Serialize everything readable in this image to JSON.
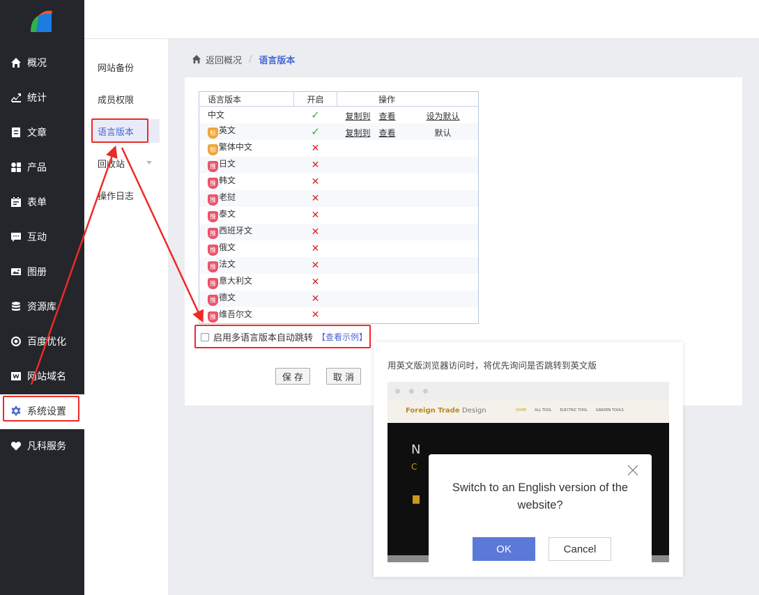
{
  "sidebar": {
    "items": [
      {
        "label": "概况",
        "icon": "home-icon"
      },
      {
        "label": "统计",
        "icon": "chart-icon"
      },
      {
        "label": "文章",
        "icon": "article-icon"
      },
      {
        "label": "产品",
        "icon": "grid-icon"
      },
      {
        "label": "表单",
        "icon": "calendar-icon"
      },
      {
        "label": "互动",
        "icon": "chat-icon"
      },
      {
        "label": "图册",
        "icon": "image-icon"
      },
      {
        "label": "资源库",
        "icon": "database-icon"
      },
      {
        "label": "百度优化",
        "icon": "target-icon"
      },
      {
        "label": "网站域名",
        "icon": "w-icon"
      },
      {
        "label": "系统设置",
        "icon": "gear-icon"
      },
      {
        "label": "凡科服务",
        "icon": "heart-icon"
      }
    ]
  },
  "submenu": {
    "items": [
      "网站备份",
      "成员权限",
      "语言版本",
      "回收站",
      "操作日志"
    ]
  },
  "breadcrumb": {
    "back": "返回概况",
    "sep": "/",
    "current": "语言版本"
  },
  "table": {
    "headers": [
      "语言版本",
      "开启",
      "操作"
    ],
    "rows": [
      {
        "name": "中文",
        "tag": "",
        "enabled": true,
        "copy": "复制到",
        "view": "查看",
        "default": "设为默认"
      },
      {
        "name": "英文",
        "tag": "标",
        "enabled": true,
        "copy": "复制到",
        "view": "查看",
        "default": "默认"
      },
      {
        "name": "繁体中文",
        "tag": "标",
        "enabled": false
      },
      {
        "name": "日文",
        "tag": "推",
        "enabled": false
      },
      {
        "name": "韩文",
        "tag": "推",
        "enabled": false
      },
      {
        "name": "老挝",
        "tag": "推",
        "enabled": false
      },
      {
        "name": "泰文",
        "tag": "推",
        "enabled": false
      },
      {
        "name": "西班牙文",
        "tag": "推",
        "enabled": false
      },
      {
        "name": "俄文",
        "tag": "推",
        "enabled": false
      },
      {
        "name": "法文",
        "tag": "推",
        "enabled": false
      },
      {
        "name": "意大利文",
        "tag": "推",
        "enabled": false
      },
      {
        "name": "德文",
        "tag": "推",
        "enabled": false
      },
      {
        "name": "维吾尔文",
        "tag": "推",
        "enabled": false
      }
    ]
  },
  "auto_redirect": {
    "label": "启用多语言版本自动跳转",
    "example_link": "【查看示例】",
    "checked": false
  },
  "buttons": {
    "save": "保 存",
    "cancel": "取 消"
  },
  "tooltip": {
    "description": "用英文版浏览器访问时，将优先询问是否跳转到英文版",
    "site_brand": "Foreign Trade",
    "site_brand_suffix": "Design",
    "site_menu": [
      "HOME",
      "ALL TOOL",
      "ELECTRIC TOOL",
      "GARDEN TOOLS"
    ],
    "hero_letter1": "N",
    "hero_letter2": "C",
    "dialog_message": "Switch to an English version of the website?",
    "ok": "OK",
    "cancel": "Cancel"
  },
  "colors": {
    "accent": "#4a67d3",
    "sidebar_bg": "#24262b",
    "annotation": "#ee2a24",
    "dialog_ok": "#5b79d6"
  }
}
